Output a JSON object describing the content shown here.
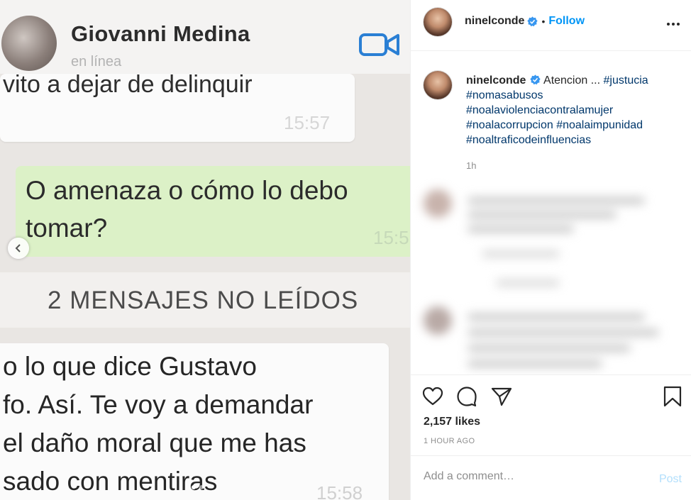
{
  "media": {
    "wa_contact_name": "Giovanni Medina",
    "wa_status": "en línea",
    "bubble1_text": "vito a dejar de delinquir",
    "bubble1_time": "15:57",
    "green_text": "O amenaza o cómo lo debo tomar?",
    "green_time": "15:5",
    "unread_label": "2 MENSAJES NO LEÍDOS",
    "bubble2_lines": [
      "o lo que dice Gustavo",
      "fo. Así. Te voy a demandar",
      "el daño moral que me has",
      "sado con mentiras"
    ],
    "bubble2_time": "15:58",
    "carousel_dots": 2,
    "carousel_active": 1
  },
  "header": {
    "username": "ninelconde",
    "separator": "•",
    "follow_label": "Follow"
  },
  "caption": {
    "username": "ninelconde",
    "text": "Atencion ...",
    "hashtags": [
      "#justucia",
      "#nomasabusos",
      "#noalaviolenciacontralamujer",
      "#noalacorrupcion",
      "#noalaimpunidad",
      "#noaltraficodeinfluencias"
    ],
    "time": "1h"
  },
  "engagement": {
    "likes": "2,157 likes",
    "date": "1 HOUR AGO"
  },
  "comment_box": {
    "placeholder": "Add a comment…",
    "post_label": "Post"
  },
  "colors": {
    "accent": "#0095f6",
    "hashtag": "#00376b",
    "verified": "#3897f0",
    "whatsapp_green_bubble": "#dcf1c7",
    "post_disabled": "#b2dffc"
  }
}
